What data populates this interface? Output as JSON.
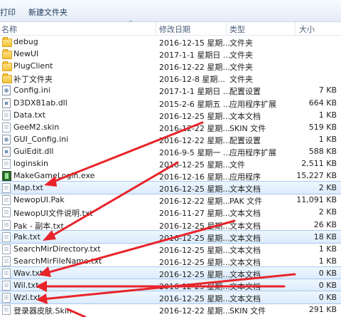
{
  "toolbar": {
    "print_label": "打印",
    "new_folder_label": "新建文件夹"
  },
  "columns": {
    "name": "名称",
    "date": "修改日期",
    "type": "类型",
    "size": "大小"
  },
  "files": [
    {
      "name": "debug",
      "date": "2016-12-15 星期...",
      "type": "文件夹",
      "size": "",
      "icon": "folder-icon"
    },
    {
      "name": "NewUI",
      "date": "2017-1-1 星期日 ...",
      "type": "文件夹",
      "size": "",
      "icon": "folder-icon"
    },
    {
      "name": "PlugClient",
      "date": "2016-12-22 星期...",
      "type": "文件夹",
      "size": "",
      "icon": "folder-icon"
    },
    {
      "name": "补丁文件夹",
      "date": "2016-12-8 星期...",
      "type": "文件夹",
      "size": "",
      "icon": "folder-icon"
    },
    {
      "name": "Config.ini",
      "date": "2017-1-1 星期日 ...",
      "type": "配置设置",
      "size": "7 KB",
      "icon": "config-file-icon"
    },
    {
      "name": "D3DX81ab.dll",
      "date": "2015-2-6 星期五 ...",
      "type": "应用程序扩展",
      "size": "664 KB",
      "icon": "dll-file-icon"
    },
    {
      "name": "Data.txt",
      "date": "2016-12-25 星期...",
      "type": "文本文档",
      "size": "1 KB",
      "icon": "text-file-icon"
    },
    {
      "name": "GeeM2.skin",
      "date": "2016-12-22 星期...",
      "type": "SKIN 文件",
      "size": "519 KB",
      "icon": "skin-file-icon"
    },
    {
      "name": "GUI_Config.ini",
      "date": "2016-12-22 星期...",
      "type": "配置设置",
      "size": "1 KB",
      "icon": "config-file-icon"
    },
    {
      "name": "GuiEdit.dll",
      "date": "2016-9-5 星期一 ...",
      "type": "应用程序扩展",
      "size": "588 KB",
      "icon": "dll-file-icon"
    },
    {
      "name": "loginskin",
      "date": "2016-12-25 星期...",
      "type": "文件",
      "size": "2,511 KB",
      "icon": "file-icon"
    },
    {
      "name": "MakeGameLogin.exe",
      "date": "2016-12-16 星期...",
      "type": "应用程序",
      "size": "15,227 KB",
      "icon": "exe-file-icon"
    },
    {
      "name": "Map.txt",
      "date": "2016-12-25 星期...",
      "type": "文本文档",
      "size": "2 KB",
      "icon": "text-file-icon",
      "selected": true
    },
    {
      "name": "NewopUI.Pak",
      "date": "2016-12-22 星期...",
      "type": "PAK 文件",
      "size": "11,091 KB",
      "icon": "pak-file-icon"
    },
    {
      "name": "NewopUI文件说明.txt",
      "date": "2016-11-27 星期...",
      "type": "文本文档",
      "size": "2 KB",
      "icon": "text-file-icon"
    },
    {
      "name": "Pak - 副本.txt",
      "date": "2016-12-25 星期...",
      "type": "文本文档",
      "size": "26 KB",
      "icon": "text-file-icon"
    },
    {
      "name": "Pak.txt",
      "date": "2016-12-25 星期...",
      "type": "文本文档",
      "size": "18 KB",
      "icon": "text-file-icon",
      "selected": true
    },
    {
      "name": "SearchMirDirectory.txt",
      "date": "2016-12-25 星期...",
      "type": "文本文档",
      "size": "1 KB",
      "icon": "text-file-icon"
    },
    {
      "name": "SearchMirFileName.txt",
      "date": "2016-12-25 星期...",
      "type": "文本文档",
      "size": "1 KB",
      "icon": "text-file-icon"
    },
    {
      "name": "Wav.txt",
      "date": "2016-12-25 星期...",
      "type": "文本文档",
      "size": "0 KB",
      "icon": "text-file-icon",
      "selected": true
    },
    {
      "name": "Wil.txt",
      "date": "2016-12-25 星期...",
      "type": "文本文档",
      "size": "0 KB",
      "icon": "text-file-icon",
      "selected": true
    },
    {
      "name": "Wzl.txt",
      "date": "2016-12-25 星期...",
      "type": "文本文档",
      "size": "0 KB",
      "icon": "text-file-icon",
      "selected": true
    },
    {
      "name": "登录器皮肤.Skin",
      "date": "2016-12-22 星期...",
      "type": "SKIN 文件",
      "size": "291 KB",
      "icon": "skin-file-icon"
    }
  ],
  "annotation_color": "#e8242a",
  "selection_color": "#dcebfc"
}
